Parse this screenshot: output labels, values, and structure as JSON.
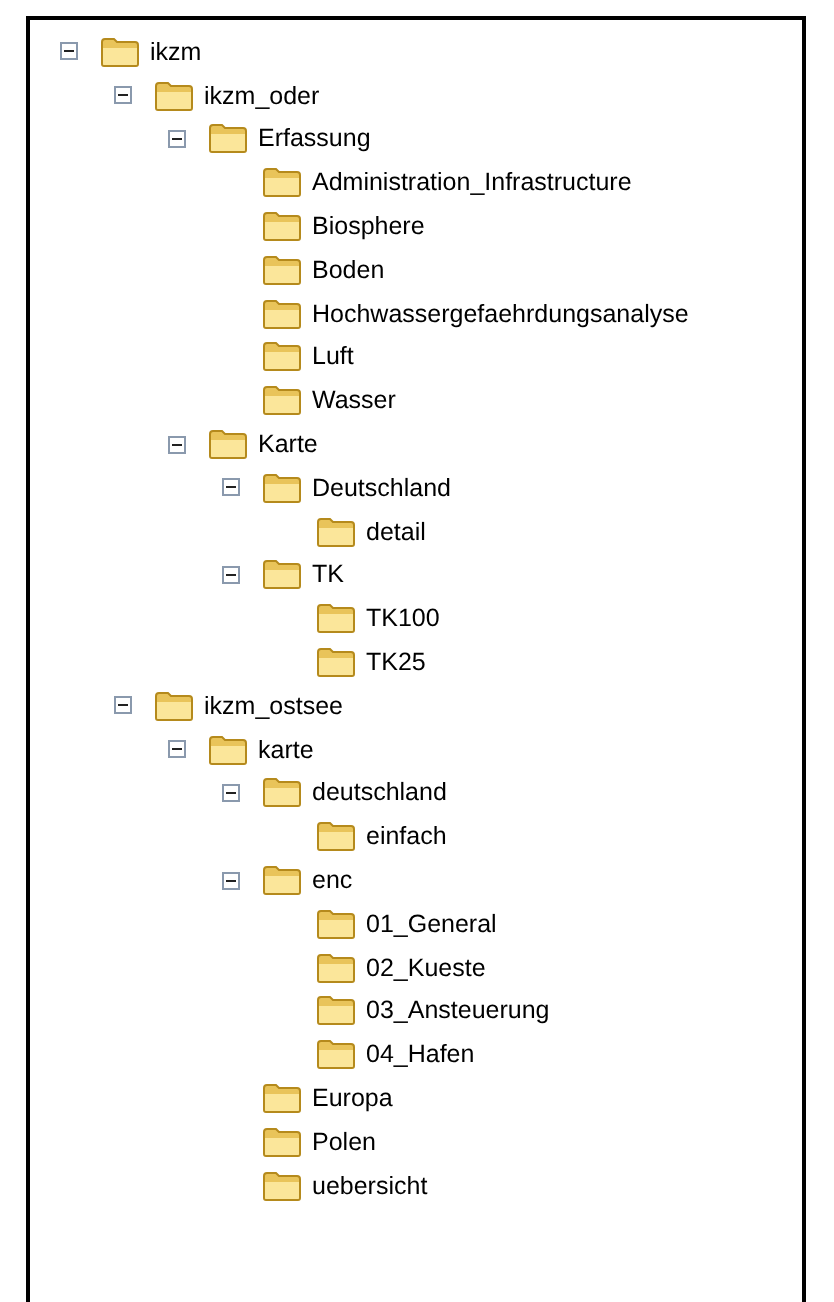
{
  "tree": [
    {
      "label": "ikzm",
      "expanded": true,
      "children": [
        {
          "label": "ikzm_oder",
          "expanded": true,
          "children": [
            {
              "label": "Erfassung",
              "expanded": true,
              "children": [
                {
                  "label": "Administration_Infrastructure"
                },
                {
                  "label": "Biosphere"
                },
                {
                  "label": "Boden"
                },
                {
                  "label": "Hochwassergefaehrdungsanalyse"
                },
                {
                  "label": "Luft"
                },
                {
                  "label": "Wasser"
                }
              ]
            },
            {
              "label": "Karte",
              "expanded": true,
              "children": [
                {
                  "label": "Deutschland",
                  "expanded": true,
                  "children": [
                    {
                      "label": "detail"
                    }
                  ]
                },
                {
                  "label": "TK",
                  "expanded": true,
                  "children": [
                    {
                      "label": "TK100"
                    },
                    {
                      "label": "TK25"
                    }
                  ]
                }
              ]
            }
          ]
        },
        {
          "label": "ikzm_ostsee",
          "expanded": true,
          "children": [
            {
              "label": "karte",
              "expanded": true,
              "children": [
                {
                  "label": "deutschland",
                  "expanded": true,
                  "children": [
                    {
                      "label": "einfach"
                    }
                  ]
                },
                {
                  "label": "enc",
                  "expanded": true,
                  "children": [
                    {
                      "label": "01_General"
                    },
                    {
                      "label": "02_Kueste"
                    },
                    {
                      "label": "03_Ansteuerung"
                    },
                    {
                      "label": "04_Hafen"
                    }
                  ]
                },
                {
                  "label": "Europa"
                },
                {
                  "label": "Polen"
                },
                {
                  "label": "uebersicht"
                }
              ]
            }
          ]
        }
      ]
    }
  ]
}
